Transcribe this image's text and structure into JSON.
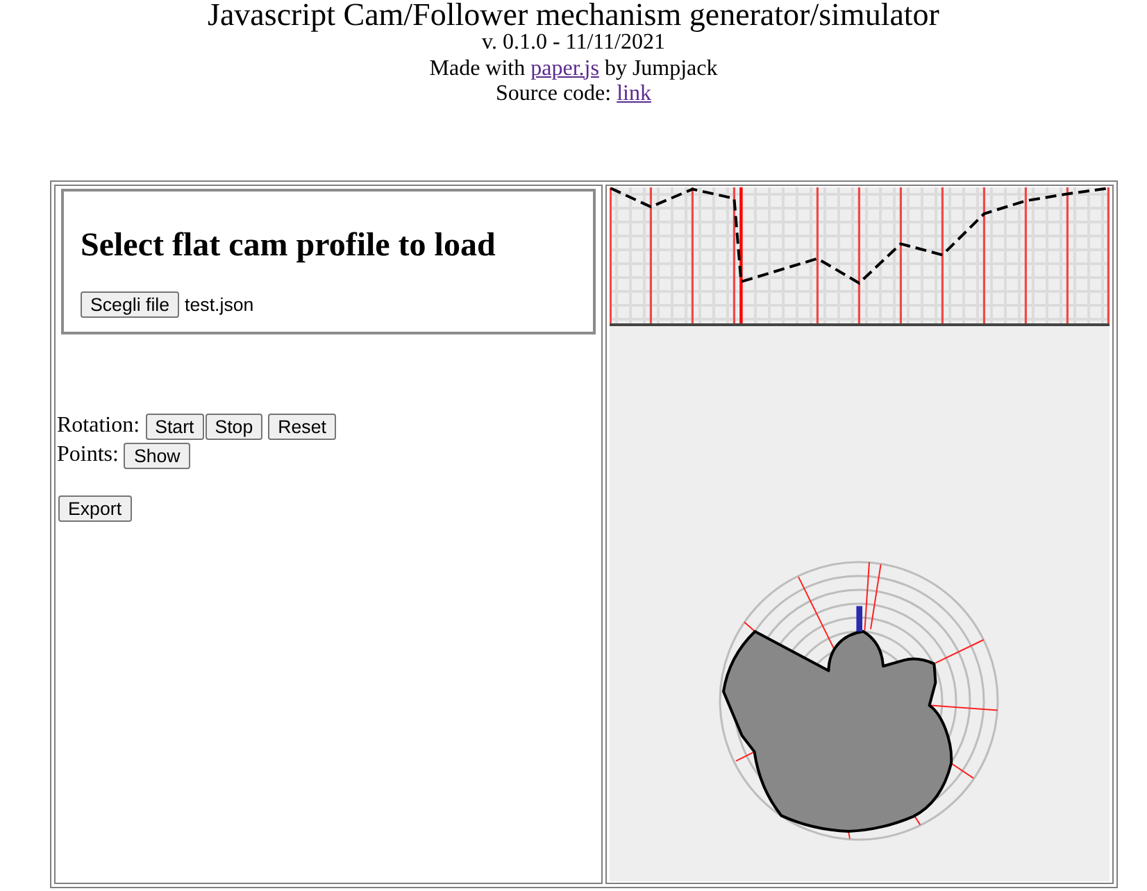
{
  "header": {
    "title": "Javascript Cam/Follower mechanism generator/simulator",
    "version": "v. 0.1.0 - 11/11/2021",
    "credits": {
      "before": "Made with",
      "link": "paper.js",
      "after": "by Jumpjack"
    },
    "source": {
      "label": "Source code:",
      "link": "link"
    }
  },
  "loader": {
    "heading": "Select flat cam profile to load",
    "file_button": "Scegli file",
    "file_name": "test.json"
  },
  "controls": [
    {
      "label": "Rotation:",
      "buttons": [
        "Start",
        "Stop",
        "Reset"
      ]
    },
    {
      "label": "Points:",
      "buttons": [
        "Show"
      ]
    }
  ],
  "export_button": "Export"
}
